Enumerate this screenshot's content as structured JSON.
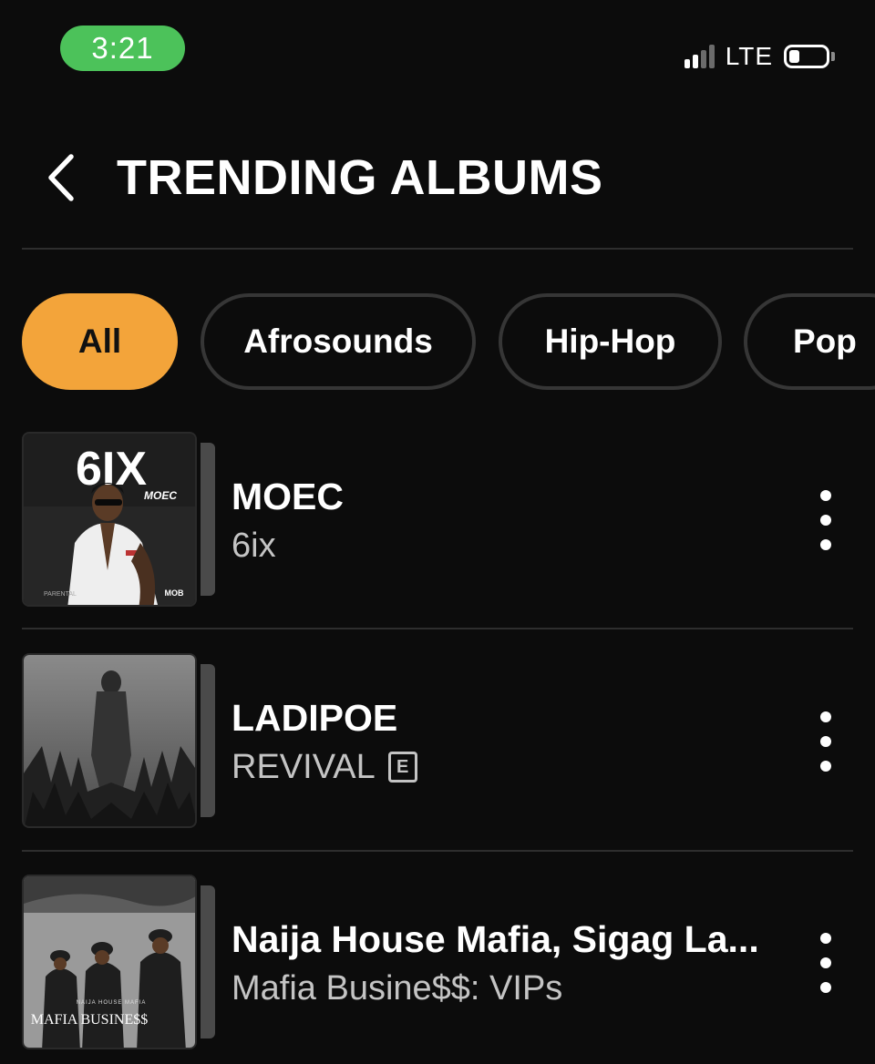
{
  "status_bar": {
    "time": "3:21",
    "network": "LTE",
    "signal_bars_active": 2,
    "signal_bars_total": 4,
    "battery_level": 0.15
  },
  "header": {
    "title": "TRENDING ALBUMS",
    "back_icon": "chevron-left-icon"
  },
  "filters": [
    {
      "label": "All",
      "active": true
    },
    {
      "label": "Afrosounds",
      "active": false
    },
    {
      "label": "Hip-Hop",
      "active": false
    },
    {
      "label": "Pop",
      "active": false
    }
  ],
  "albums": [
    {
      "artist": "MOEC",
      "title": "6ix",
      "explicit": false,
      "cover_text": "6IX",
      "cover_subtext": "MOEC",
      "cover_label": "MOB"
    },
    {
      "artist": "LADIPOE",
      "title": "REVIVAL",
      "explicit": true,
      "explicit_label": "E"
    },
    {
      "artist": "Naija House Mafia, Sigag La...",
      "title": "Mafia Busine$$: VIPs",
      "explicit": false,
      "cover_text": "MAFIA BUSINE$$",
      "cover_subtext": "NAIJA HOUSE MAFIA"
    }
  ],
  "colors": {
    "background": "#0c0c0c",
    "accent": "#f3a43a",
    "status_pill": "#4cc25a",
    "divider": "#2e2e2e",
    "secondary_text": "#c4c4c4"
  }
}
